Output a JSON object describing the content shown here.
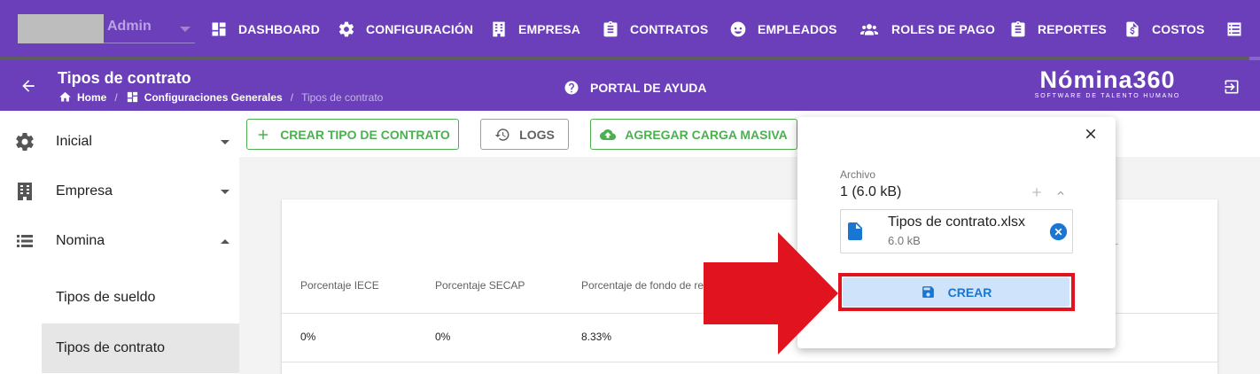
{
  "user": {
    "name": "Admin"
  },
  "topnav": {
    "items": [
      {
        "label": "DASHBOARD",
        "icon": "dashboard-icon"
      },
      {
        "label": "CONFIGURACIÓN",
        "icon": "gear-icon"
      },
      {
        "label": "EMPRESA",
        "icon": "building-icon"
      },
      {
        "label": "CONTRATOS",
        "icon": "clipboard-icon"
      },
      {
        "label": "EMPLEADOS",
        "icon": "face-icon"
      },
      {
        "label": "ROLES DE PAGO",
        "icon": "users-icon"
      },
      {
        "label": "REPORTES",
        "icon": "clipboard-list-icon"
      },
      {
        "label": "COSTOS",
        "icon": "file-dollar-icon"
      }
    ]
  },
  "header": {
    "title": "Tipos de contrato",
    "breadcrumb": [
      "Home",
      "Configuraciones Generales",
      "Tipos de contrato"
    ],
    "help_label": "PORTAL DE AYUDA",
    "brand_name": "Nómina360",
    "brand_tagline": "SOFTWARE DE TALENTO HUMANO"
  },
  "sidebar": {
    "items": [
      {
        "label": "Inicial",
        "icon": "gear-icon",
        "expanded": false
      },
      {
        "label": "Empresa",
        "icon": "building-icon",
        "expanded": false
      },
      {
        "label": "Nomina",
        "icon": "list-icon",
        "expanded": true
      }
    ],
    "subitems": [
      {
        "label": "Tipos de sueldo",
        "active": false
      },
      {
        "label": "Tipos de contrato",
        "active": true
      }
    ]
  },
  "toolbar": {
    "create_label": "CREAR TIPO DE CONTRATO",
    "logs_label": "LOGS",
    "bulk_label": "AGREGAR CARGA MASIVA"
  },
  "table": {
    "columns": [
      "Porcentaje IECE",
      "Porcentaje SECAP",
      "Porcentaje de fondo de re"
    ],
    "rows": [
      [
        "0%",
        "0%",
        "8.33%"
      ]
    ]
  },
  "upload_popup": {
    "field_label": "Archivo",
    "count_text": "1 (6.0 kB)",
    "file_name": "Tipos de contrato.xlsx",
    "file_size": "6.0 kB",
    "submit_label": "CREAR"
  },
  "colors": {
    "brand_purple": "#6a3fb9",
    "success_green": "#4caf50",
    "primary_blue": "#1976d2",
    "highlight_red": "#e0131f"
  }
}
